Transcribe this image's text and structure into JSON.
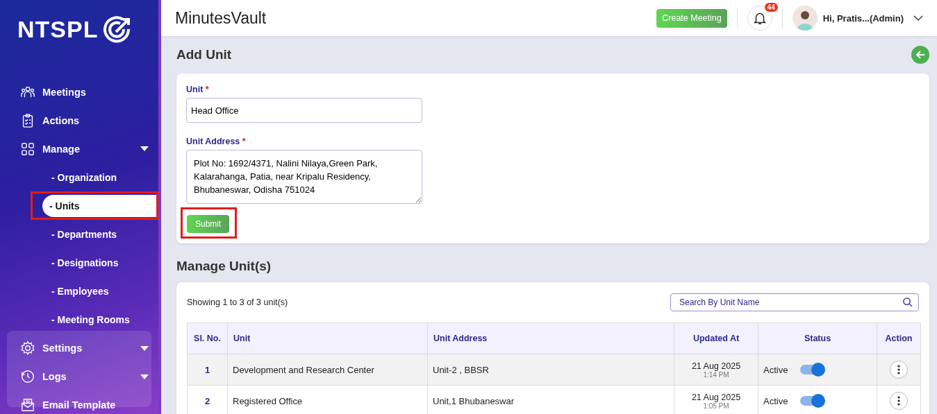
{
  "sidebar": {
    "logo": "NTSPL",
    "items": [
      {
        "label": "Meetings"
      },
      {
        "label": "Actions"
      },
      {
        "label": "Manage",
        "expanded": true,
        "children": [
          {
            "label": "- Organization",
            "selected": false,
            "highlighted": false
          },
          {
            "label": "- Units",
            "selected": true,
            "highlighted": true
          },
          {
            "label": "- Departments",
            "selected": false,
            "highlighted": false
          },
          {
            "label": "- Designations",
            "selected": false,
            "highlighted": false
          },
          {
            "label": "- Employees",
            "selected": false,
            "highlighted": false
          },
          {
            "label": "- Meeting Rooms",
            "selected": false,
            "highlighted": false
          }
        ]
      },
      {
        "label": "Settings",
        "expanded": false
      },
      {
        "label": "Logs",
        "expanded": false
      },
      {
        "label": "Email Template"
      }
    ]
  },
  "header": {
    "title": "MinutesVault",
    "create_button": "Create Meeting",
    "notification_count": "44",
    "user": "Hi, Pratis...(Admin)"
  },
  "add_unit": {
    "title": "Add Unit",
    "unit_label": "Unit",
    "required_mark": "*",
    "unit_value": "Head Office",
    "address_label": "Unit Address",
    "address_required_mark": "*",
    "address_value": "Plot No: 1692/4371, Nalini Nilaya,Green Park, Kalarahanga, Patia, near Kripalu Residency, Bhubaneswar, Odisha 751024",
    "submit": "Submit",
    "submit_highlighted": true
  },
  "manage_units": {
    "title": "Manage Unit(s)",
    "showing": "Showing 1 to 3 of 3 unit(s)",
    "search": {
      "placeholder": "Search By Unit Name"
    },
    "table": {
      "columns": [
        "Sl. No.",
        "Unit",
        "Unit Address",
        "Updated At",
        "Status",
        "Action"
      ],
      "rows": [
        {
          "sl": "1",
          "unit": "Development and Research Center",
          "address": "Unit-2 , BBSR",
          "date": "21 Aug 2025",
          "time": "1:14 PM",
          "status": "Active",
          "on": true
        },
        {
          "sl": "2",
          "unit": "Registered Office",
          "address": "Unit,1 Bhubaneswar",
          "date": "21 Aug 2025",
          "time": "1:05 PM",
          "status": "Active",
          "on": true
        }
      ]
    }
  }
}
